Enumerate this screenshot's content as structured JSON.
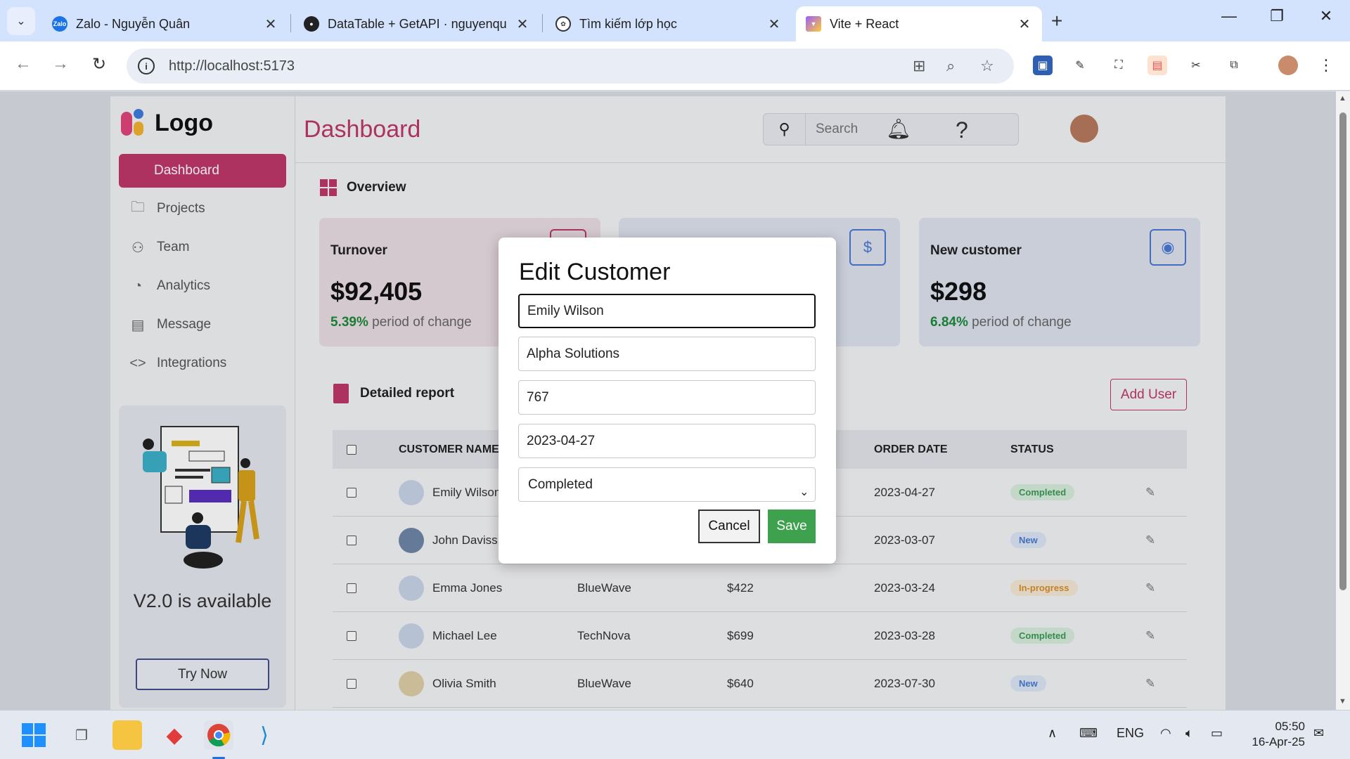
{
  "browser": {
    "tabs": [
      {
        "title": "Zalo - Nguyễn Quân",
        "icon": "zalo-icon",
        "active": false
      },
      {
        "title": "DataTable + GetAPI · nguyenqu",
        "icon": "github-icon",
        "active": false
      },
      {
        "title": "Tìm kiếm lớp học",
        "icon": "openai-icon",
        "active": false
      },
      {
        "title": "Vite + React",
        "icon": "vite-icon",
        "active": true
      }
    ],
    "url": "http://localhost:5173"
  },
  "sidebar": {
    "logo_text": "Logo",
    "items": [
      {
        "label": "Dashboard",
        "icon": "dashboard-icon",
        "active": true
      },
      {
        "label": "Projects",
        "icon": "folder-icon"
      },
      {
        "label": "Team",
        "icon": "team-icon"
      },
      {
        "label": "Analytics",
        "icon": "pie-chart-icon"
      },
      {
        "label": "Message",
        "icon": "message-icon"
      },
      {
        "label": "Integrations",
        "icon": "code-icon"
      }
    ],
    "promo": {
      "title": "V2.0 is available",
      "button": "Try Now"
    }
  },
  "header": {
    "title": "Dashboard",
    "search_placeholder": "Search"
  },
  "overview": {
    "title": "Overview",
    "cards": [
      {
        "title": "Turnover",
        "value": "$92,405",
        "change": "5.39%",
        "change_text": "period of change"
      },
      {
        "title": "",
        "value": "",
        "change": "",
        "change_text": ""
      },
      {
        "title": "New customer",
        "value": "$298",
        "change": "6.84%",
        "change_text": "period of change"
      }
    ]
  },
  "report": {
    "title": "Detailed report",
    "add_user": "Add User",
    "columns": [
      "CUSTOMER NAME",
      "ORDER DATE",
      "STATUS"
    ],
    "rows": [
      {
        "name": "Emily Wilson",
        "company": "",
        "value": "",
        "date": "2023-04-27",
        "status": "Completed"
      },
      {
        "name": "John Daviss",
        "company": "",
        "value": "",
        "date": "2023-03-07",
        "status": "New"
      },
      {
        "name": "Emma Jones",
        "company": "BlueWave",
        "value": "$422",
        "date": "2023-03-24",
        "status": "In-progress"
      },
      {
        "name": "Michael Lee",
        "company": "TechNova",
        "value": "$699",
        "date": "2023-03-28",
        "status": "Completed"
      },
      {
        "name": "Olivia Smith",
        "company": "BlueWave",
        "value": "$640",
        "date": "2023-07-30",
        "status": "New"
      }
    ]
  },
  "modal": {
    "title": "Edit Customer",
    "name": "Emily Wilson",
    "company": "Alpha Solutions",
    "value": "767",
    "date": "2023-04-27",
    "status": "Completed",
    "cancel": "Cancel",
    "save": "Save"
  },
  "taskbar": {
    "lang": "ENG",
    "time": "05:50",
    "date": "16-Apr-25"
  },
  "colors": {
    "accent": "#c03769",
    "save": "#3ea14d",
    "card_blue": "#4b78d6"
  }
}
